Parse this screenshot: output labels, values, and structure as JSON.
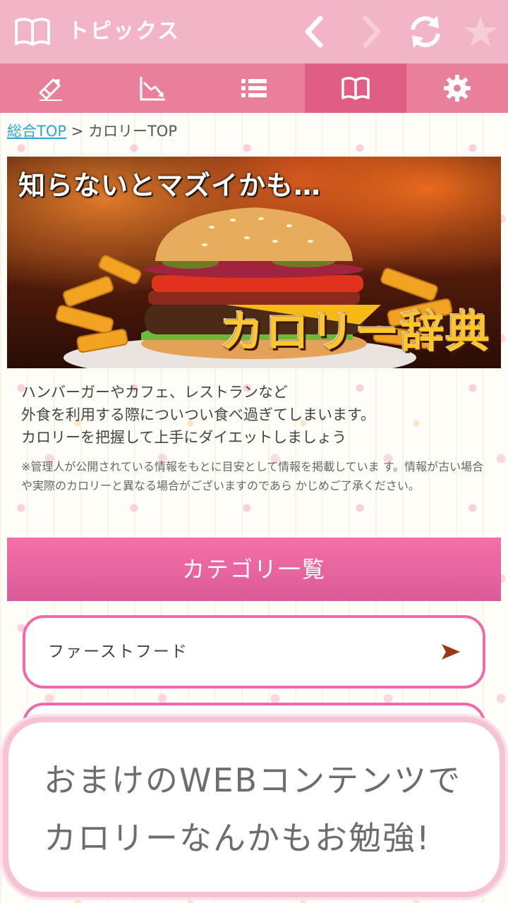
{
  "topbar": {
    "title": "トピックス",
    "icons": [
      "book-icon",
      "back-icon",
      "forward-icon",
      "reload-icon",
      "star-icon"
    ]
  },
  "tabs": [
    {
      "icon": "pencil-icon",
      "active": false
    },
    {
      "icon": "chart-down-icon",
      "active": false
    },
    {
      "icon": "list-icon",
      "active": false
    },
    {
      "icon": "book-icon",
      "active": true
    },
    {
      "icon": "gear-icon",
      "active": false
    }
  ],
  "breadcrumb": {
    "home_link": "総合TOP",
    "separator": " > ",
    "current": "カロリーTOP"
  },
  "banner": {
    "headline": "知らないとマズイかも…",
    "title": "カロリー辞典"
  },
  "description": {
    "line1": "ハンバーガーやカフェ、レストランなど",
    "line2": "外食を利用する際についつい食べ過ぎてしまいます。",
    "line3": "カロリーを把握して上手にダイエットしましょう",
    "note": "※管理人が公開されている情報をもとに目安として情報を掲載していま す。情報が古い場合や実際のカロリーと異なる場合がございますのであら かじめご了承ください。"
  },
  "categories": {
    "header": "カテゴリ一覧",
    "items": [
      {
        "label": "ファーストフード"
      },
      {
        "label": ""
      }
    ]
  },
  "promo": {
    "line1": "おまけのWEBコンテンツで",
    "line2": "カロリーなんかもお勉強!"
  },
  "colors": {
    "topbar": "#f2b4c7",
    "tabbar": "#ea7f9c",
    "tab_active": "#e05d86",
    "link": "#2aa7c9",
    "category_header": "#f66fa8",
    "item_border": "#f06aaa"
  }
}
